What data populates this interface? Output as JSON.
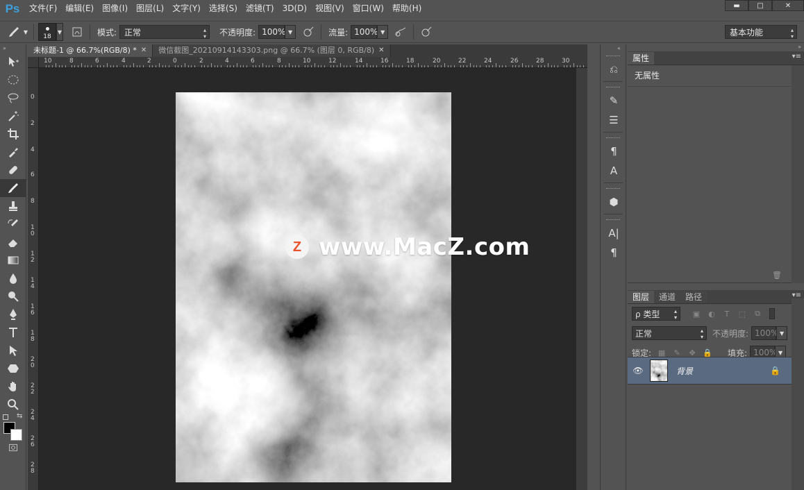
{
  "app": {
    "logo": "Ps"
  },
  "menu": [
    "文件(F)",
    "编辑(E)",
    "图像(I)",
    "图层(L)",
    "文字(Y)",
    "选择(S)",
    "滤镜(T)",
    "3D(D)",
    "视图(V)",
    "窗口(W)",
    "帮助(H)"
  ],
  "window_controls": {
    "minimize": "▬",
    "maximize": "□",
    "close": "✕"
  },
  "options": {
    "brush_size": "18",
    "mode_label": "模式:",
    "mode_value": "正常",
    "opacity_label": "不透明度:",
    "opacity_value": "100%",
    "flow_label": "流量:",
    "flow_value": "100%",
    "workspace": "基本功能"
  },
  "tabs": [
    {
      "label": "未标题-1 @ 66.7%(RGB/8) *",
      "active": true
    },
    {
      "label": "微信截图_20210914143303.png @ 66.7% (图层 0, RGB/8)",
      "active": false
    }
  ],
  "ruler_top_ticks": [
    "10",
    "8",
    "6",
    "4",
    "2",
    "0",
    "2",
    "4",
    "6",
    "8",
    "10",
    "12",
    "14",
    "16",
    "18",
    "20",
    "22",
    "24",
    "26",
    "28",
    "30"
  ],
  "ruler_left_ticks": [
    "0",
    "2",
    "4",
    "6",
    "8",
    "1\n0",
    "1\n2",
    "1\n4",
    "1\n6",
    "1\n8",
    "2\n0",
    "2\n2",
    "2\n4",
    "2\n6",
    "2\n8"
  ],
  "watermark": {
    "badge": "Z",
    "text": "www.MacZ.com"
  },
  "properties": {
    "tab": "属性",
    "content": "无属性"
  },
  "layers": {
    "tabs": [
      "图层",
      "通道",
      "路径"
    ],
    "filter_label": "ρ 类型",
    "blend_mode": "正常",
    "opacity_label": "不透明度:",
    "opacity_value": "100%",
    "lock_label": "锁定:",
    "fill_label": "填充:",
    "fill_value": "100%",
    "items": [
      {
        "name": "背景",
        "locked": true,
        "visible": true
      }
    ]
  },
  "colors": {
    "accent": "#3ca0dc",
    "selected_layer": "#5a6a80",
    "foreground": "#000000",
    "background": "#ffffff"
  }
}
